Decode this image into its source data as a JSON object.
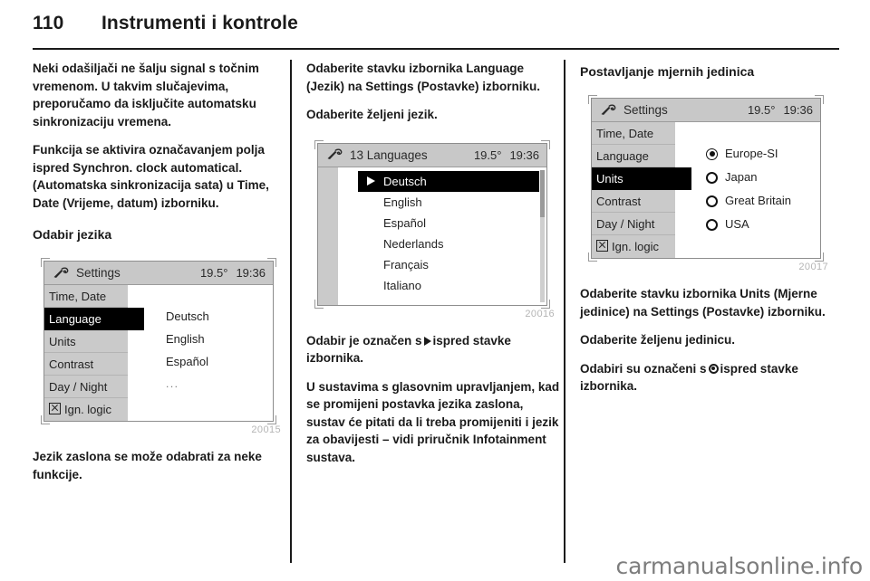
{
  "header": {
    "page_number": "110",
    "chapter_title": "Instrumenti i kontrole"
  },
  "column1": {
    "para1": "Neki odašiljači ne šalju signal s točnim vremenom. U takvim slučajevima, preporučamo da isključite automatsku sinkronizaciju vremena.",
    "para2": "Funkcija se aktivira označavanjem polja ispred Synchron. clock automatical. (Automatska sinkronizacija sata) u Time, Date (Vrijeme, datum) izborniku.",
    "subhead": "Odabir jezika",
    "figure": {
      "id": "20015",
      "title": "Settings",
      "temperature": "19.5°",
      "clock": "19:36",
      "menu_items": [
        "Time, Date",
        "Language",
        "Units",
        "Contrast",
        "Day / Night",
        "Ign. logic"
      ],
      "selected_menu_item": "Language",
      "values": [
        "Deutsch",
        "English",
        "Español",
        "..."
      ]
    },
    "para3": "Jezik zaslona se može odabrati za neke funkcije."
  },
  "column2": {
    "para1": "Odaberite stavku izbornika Language (Jezik) na Settings (Postavke) izborniku.",
    "para2": "Odaberite željeni jezik.",
    "figure": {
      "id": "20016",
      "title": "13 Languages",
      "temperature": "19.5°",
      "clock": "19:36",
      "languages": [
        "Deutsch",
        "English",
        "Español",
        "Nederlands",
        "Français",
        "Italiano"
      ],
      "selected_language": "Deutsch"
    },
    "para3_before": "Odabir je označen s",
    "para3_after": "ispred stavke izbornika.",
    "para4": "U sustavima s glasovnim upravljanjem, kad se promijeni postavka jezika zaslona, sustav će pitati da li treba promijeniti i jezik za obavijesti – vidi priručnik Infotainment sustava."
  },
  "column3": {
    "subhead": "Postavljanje mjernih jedinica",
    "figure": {
      "id": "20017",
      "title": "Settings",
      "temperature": "19.5°",
      "clock": "19:36",
      "menu_items": [
        "Time, Date",
        "Language",
        "Units",
        "Contrast",
        "Day / Night",
        "Ign. logic"
      ],
      "selected_menu_item": "Units",
      "options": [
        {
          "label": "Europe-SI",
          "selected": true
        },
        {
          "label": "Japan",
          "selected": false
        },
        {
          "label": "Great Britain",
          "selected": false
        },
        {
          "label": "USA",
          "selected": false
        }
      ]
    },
    "para1": "Odaberite stavku izbornika Units (Mjerne jedinice) na Settings (Postavke) izborniku.",
    "para2": "Odaberite željenu jedinicu.",
    "para3_before": "Odabiri su označeni s",
    "para3_after": "ispred stavke izbornika."
  },
  "watermark": "carmanualsonline.info"
}
